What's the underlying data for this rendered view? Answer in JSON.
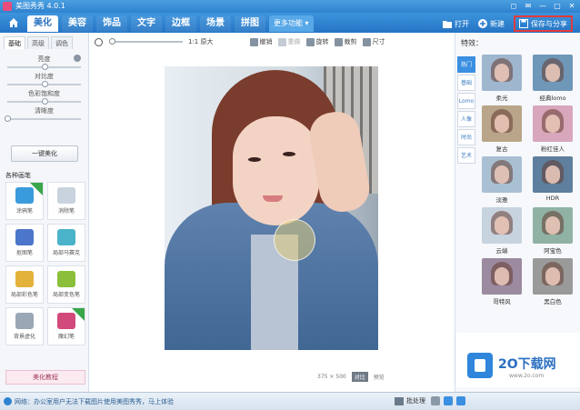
{
  "window": {
    "title": "美图秀秀 4.0.1",
    "controls": [
      "◻",
      "✉",
      "—",
      "▢",
      "✕"
    ]
  },
  "menu": {
    "tabs": [
      "美化",
      "美容",
      "饰品",
      "文字",
      "边框",
      "场景",
      "拼图"
    ],
    "active_tab": "美化",
    "more": "更多功能 ▾",
    "open": "打开",
    "new": "新建",
    "save_share": "保存与分享"
  },
  "left_panel": {
    "subtabs": [
      "基础",
      "高级",
      "调色"
    ],
    "sliders": [
      {
        "label": "亮度",
        "value": 0.5
      },
      {
        "label": "对比度",
        "value": 0.5
      },
      {
        "label": "色彩饱和度",
        "value": 0.5
      },
      {
        "label": "清晰度",
        "value": 0.0
      }
    ],
    "auto_button": "一键美化",
    "brushes_title": "各种画笔",
    "brushes": [
      {
        "label": "涂鸦笔",
        "icon": "pen-icon",
        "color": "#3a9bdc",
        "new": true
      },
      {
        "label": "消除笔",
        "icon": "eraser-icon",
        "color": "#c9d3de",
        "new": false
      },
      {
        "label": "抠图笔",
        "icon": "cutout-icon",
        "color": "#4b76c9",
        "new": false
      },
      {
        "label": "局部马赛克",
        "icon": "mosaic-icon",
        "color": "#4bb3c9",
        "new": false
      },
      {
        "label": "局部彩色笔",
        "icon": "color-pen-icon",
        "color": "#e3b23a",
        "new": false
      },
      {
        "label": "局部变色笔",
        "icon": "recolor-icon",
        "color": "#8bbf3b",
        "new": false
      },
      {
        "label": "背景虚化",
        "icon": "blur-icon",
        "color": "#9aa7b5",
        "new": false
      },
      {
        "label": "魔幻笔",
        "icon": "magic-pen-icon",
        "color": "#d24a7b",
        "new": true
      }
    ],
    "tutorial": "美化教程"
  },
  "toolbar": {
    "actual_size": "1:1 原大",
    "undo": "撤销",
    "redo": "重做",
    "rotate": "旋转",
    "crop": "裁剪",
    "resize": "尺寸",
    "zoom": 0.02
  },
  "canvas": {
    "dimensions": "375 × 500",
    "contrast": "对比",
    "preview": "预览"
  },
  "right_panel": {
    "header": "特效：",
    "categories": [
      "热门",
      "基础",
      "Lomo",
      "人像",
      "时尚",
      "艺术"
    ],
    "active_category": "热门",
    "effects": [
      {
        "label": "柔光",
        "color": "#9fb6cf"
      },
      {
        "label": "经典lomo",
        "color": "#6f97b8"
      },
      {
        "label": "复古",
        "color": "#b9a58a"
      },
      {
        "label": "粉红佳人",
        "color": "#d8a7bb"
      },
      {
        "label": "淡雅",
        "color": "#a9c0d3"
      },
      {
        "label": "HDR",
        "color": "#5e7f9d"
      },
      {
        "label": "云端",
        "color": "#c7d3df"
      },
      {
        "label": "阿宝色",
        "color": "#8fb2a5"
      },
      {
        "label": "哥特风",
        "color": "#9b8aa0"
      },
      {
        "label": "黑白色",
        "color": "#9a9a9a"
      }
    ]
  },
  "watermark": {
    "brand": "2O下载网",
    "url": "www.2o.com"
  },
  "statusbar": {
    "message": "网络：办公室用户无法下载图片使用美图秀秀，马上体验",
    "batch": "批处理"
  }
}
